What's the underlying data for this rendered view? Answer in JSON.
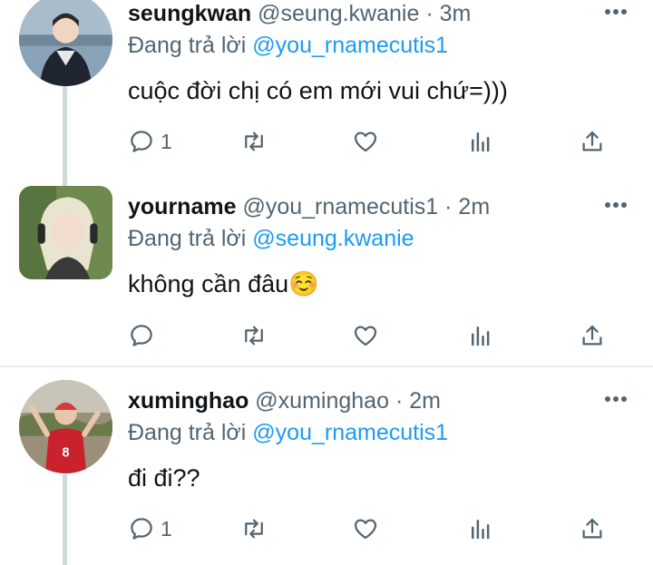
{
  "reply_prefix": "Đang trả lời",
  "colors": {
    "accent": "#1d9bf0",
    "secondary_text": "#536471",
    "primary_text": "#0f1419"
  },
  "icons": [
    "more-icon",
    "reply-icon",
    "retweet-icon",
    "like-icon",
    "views-icon",
    "share-icon",
    "relieved-face-emoji"
  ],
  "tweets": [
    {
      "display_name": "seungkwan",
      "handle": "@seung.kwanie",
      "time": "· 3m",
      "replying_to": "@you_rnamecutis1",
      "text": "cuộc đời chị có em mới vui chứ=)))",
      "emoji": "",
      "reply_count": "1"
    },
    {
      "display_name": "yourname",
      "handle": "@you_rnamecutis1",
      "time": "· 2m",
      "replying_to": "@seung.kwanie",
      "text": "không cần đâu",
      "emoji": "☺️",
      "reply_count": ""
    },
    {
      "display_name": "xuminghao",
      "handle": "@xuminghao",
      "time": "· 2m",
      "replying_to": "@you_rnamecutis1",
      "text": "đi đi??",
      "emoji": "",
      "reply_count": "1"
    }
  ]
}
